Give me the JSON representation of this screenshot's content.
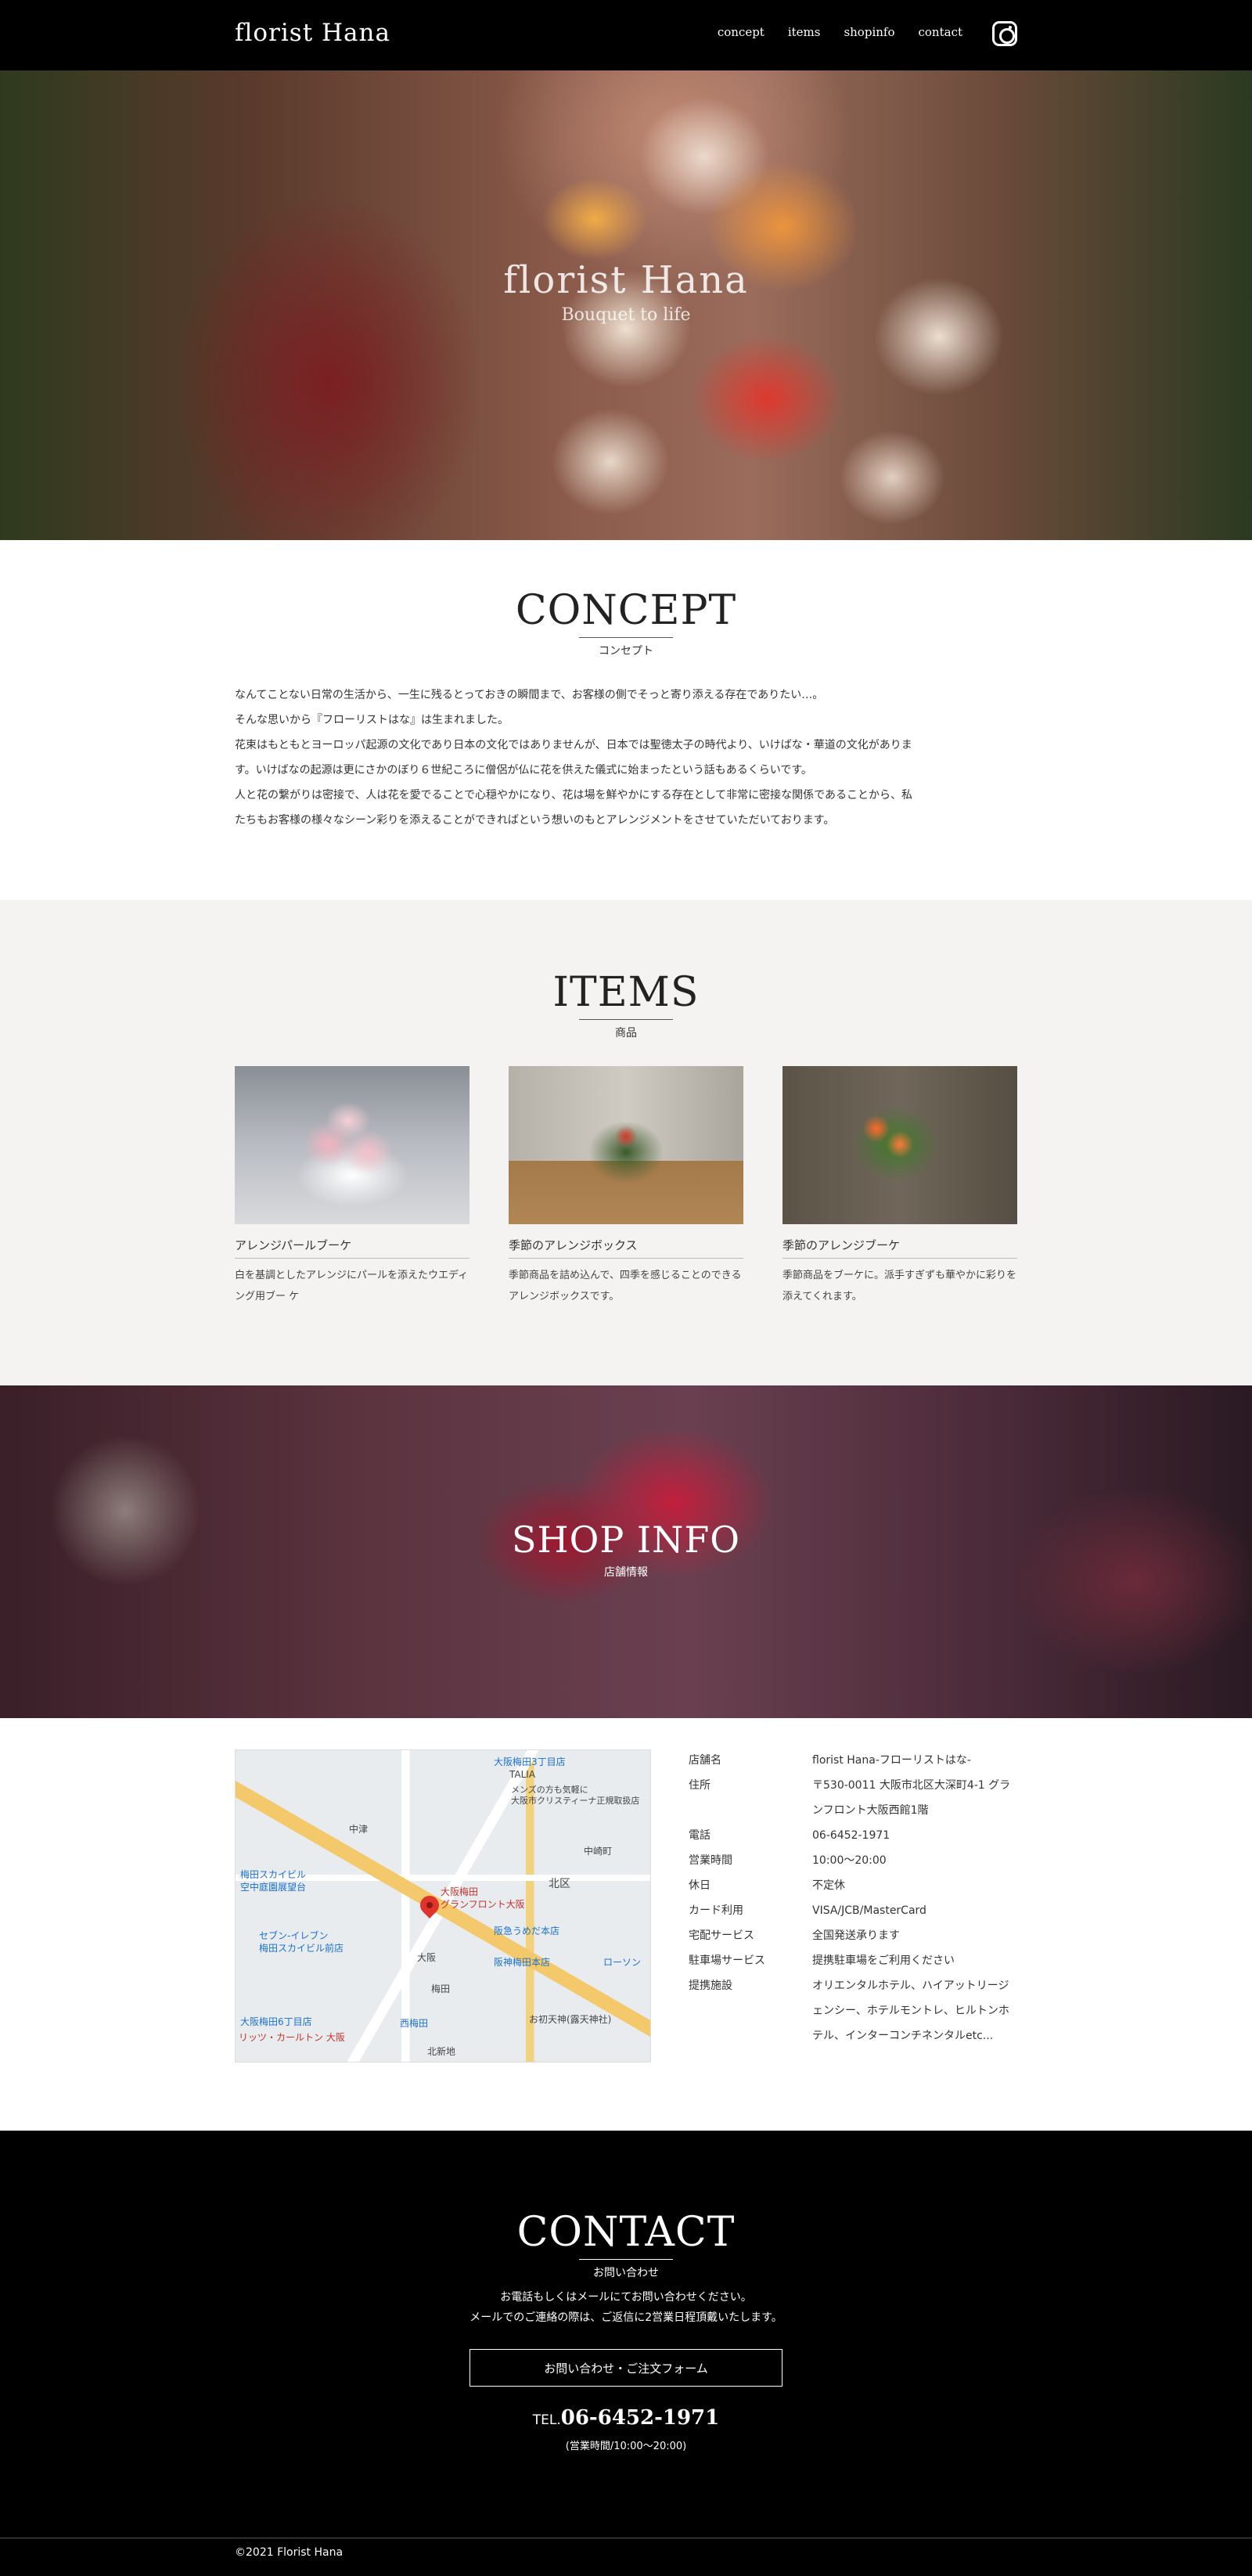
{
  "header": {
    "logo": "florist Hana",
    "nav": [
      "concept",
      "items",
      "shopinfo",
      "contact"
    ],
    "instagram_icon": "instagram-icon"
  },
  "hero": {
    "title": "florist Hana",
    "subtitle": "Bouquet to life"
  },
  "concept": {
    "title": "CONCEPT",
    "subtitle": "コンセプト",
    "paragraphs": [
      "なんてことない日常の生活から、一生に残るとっておきの瞬間まで、お客様の側でそっと寄り添える存在でありたい…。",
      "そんな思いから『フローリストはな』は生まれました。",
      "花束はもともとヨーロッパ起源の文化であり日本の文化ではありませんが、日本では聖徳太子の時代より、いけばな・華道の文化がありま",
      "す。いけばなの起源は更にさかのぼり６世紀ころに僧侶が仏に花を供えた儀式に始まったという話もあるくらいです。",
      "人と花の繋がりは密接で、人は花を愛でることで心穏やかになり、花は場を鮮やかにする存在として非常に密接な関係であることから、私",
      "たちもお客様の様々なシーン彩りを添えることができればという想いのもとアレンジメントをさせていただいております。"
    ]
  },
  "items": {
    "title": "ITEMS",
    "subtitle": "商品",
    "list": [
      {
        "name": "アレンジパールブーケ",
        "desc": "白を基調としたアレンジにパールを添えたウエディング用ブー ケ"
      },
      {
        "name": "季節のアレンジボックス",
        "desc": "季節商品を詰め込んで、四季を感じることのできるアレンジボックスです。"
      },
      {
        "name": "季節のアレンジブーケ",
        "desc": "季節商品をブーケに。派手すぎずも華やかに彩りを添えてくれます。"
      }
    ]
  },
  "shop": {
    "title": "SHOP INFO",
    "subtitle": "店舗情報",
    "map_labels": [
      "大阪梅田3丁目店",
      "TALIA",
      "メンズの方も気軽に",
      "大阪市クリスティーナ正規取扱店",
      "梅田スカイビル",
      "空中庭園展望台",
      "セブン-イレブン",
      "梅田スカイビル前店",
      "大阪梅田",
      "グランフロント大阪",
      "阪急うめだ本店",
      "阪神梅田本店",
      "北区",
      "大阪",
      "梅田",
      "西梅田",
      "お初天神(露天神社)",
      "リッツ・カールトン 大阪",
      "中崎町",
      "ローソン",
      "中津",
      "北新地",
      "大阪梅田6丁目店"
    ],
    "rows": [
      {
        "key": "店舗名",
        "val": "florist Hana-フローリストはな-"
      },
      {
        "key": "住所",
        "val": "〒530-0011 大阪市北区大深町4-1 グランフロント大阪西館1階"
      },
      {
        "key": "電話",
        "val": "06-6452-1971"
      },
      {
        "key": "営業時間",
        "val": "10:00〜20:00"
      },
      {
        "key": "休日",
        "val": "不定休"
      },
      {
        "key": "カード利用",
        "val": "VISA/JCB/MasterCard"
      },
      {
        "key": "宅配サービス",
        "val": "全国発送承ります"
      },
      {
        "key": "駐車場サービス",
        "val": "提携駐車場をご利用ください"
      },
      {
        "key": "提携施設",
        "val": "オリエンタルホテル、ハイアットリージェンシー、ホテルモントレ、ヒルトンホテル、インターコンチネンタルetc..."
      }
    ]
  },
  "contact": {
    "title": "CONTACT",
    "subtitle": "お問い合わせ",
    "line1": "お電話もしくはメールにてお問い合わせください。",
    "line2": "メールでのご連絡の際は、ご返信に2営業日程頂戴いたします。",
    "button": "お問い合わせ・ご注文フォーム",
    "tel_label": "TEL.",
    "tel_number": "06-6452-1971",
    "hours": "(営業時間/10:00〜20:00)"
  },
  "footer": {
    "copyright": "©2021 Florist Hana"
  }
}
